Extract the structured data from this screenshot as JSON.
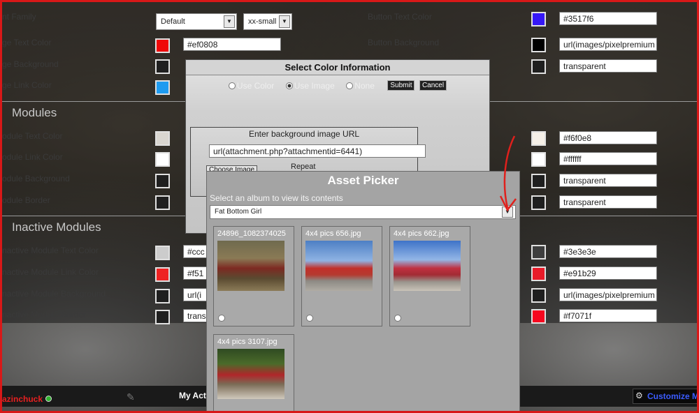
{
  "left_labels": {
    "font_family": "nt Family",
    "text_color": "ge Text Color",
    "background": "ge Background",
    "link_color": "ge Link Color",
    "module_text_color": "odule Text Color",
    "module_link_color": "odule Link Color",
    "module_background": "odule Background",
    "module_border": "odule Border",
    "inactive_text": "nactive Module Text Color",
    "inactive_link": "nactive Module Link Color",
    "inactive_background": "nactive Module Background",
    "inactive_border": "nactive Module Border"
  },
  "right_labels": {
    "button_text_color": "Button Text Color",
    "button_background": "Button Background"
  },
  "sections": {
    "modules": "Modules",
    "inactive_modules": "Inactive Modules"
  },
  "font_selects": {
    "family": "Default",
    "size": "xx-small"
  },
  "left_fields": {
    "text_color": "#ef0808",
    "inactive_text": "#ccc",
    "inactive_link": "#f51",
    "inactive_background": "url(i",
    "inactive_border": "trans"
  },
  "right_fields": {
    "button_text_color": "#3517f6",
    "button_background": "url(images/pixelpremium",
    "r3": "transparent",
    "module_text": "#f6f0e8",
    "module_link": "#ffffff",
    "module_bg": "transparent",
    "module_border": "transparent",
    "inactive_text": "#3e3e3e",
    "inactive_link": "#e91b29",
    "inactive_bg": "url(images/pixelpremium",
    "inactive_border": "#f7071f"
  },
  "color_dialog": {
    "title": "Select Color Information",
    "use_color": "Use Color",
    "use_image": "Use Image",
    "none": "None",
    "submit": "Submit",
    "cancel": "Cancel",
    "url_caption": "Enter background image URL",
    "url_value": "url(attachment.php?attachmentid=6441)",
    "choose_image": "Choose Image",
    "repeat": "Repeat"
  },
  "asset_picker": {
    "title": "Asset Picker",
    "instruction": "Select an album to view its contents",
    "album": "Fat Bottom Girl",
    "items": [
      {
        "name": "24896_1082374025"
      },
      {
        "name": "4x4 pics 656.jpg"
      },
      {
        "name": "4x4 pics 662.jpg"
      },
      {
        "name": "4x4 pics 3107.jpg"
      }
    ]
  },
  "footer": {
    "username": "azinchuck",
    "my_act": "My Act",
    "customize": "Customize M"
  },
  "colors": {
    "frame_border": "#d81818",
    "arrow_annotation": "#e0201c",
    "sw_text": "#ef0808",
    "sw_link": "#1e9bf0",
    "sw_button_text": "#3517f6",
    "sw_inactive_link": "#e91b29",
    "sw_inactive_border": "#f7071f"
  }
}
